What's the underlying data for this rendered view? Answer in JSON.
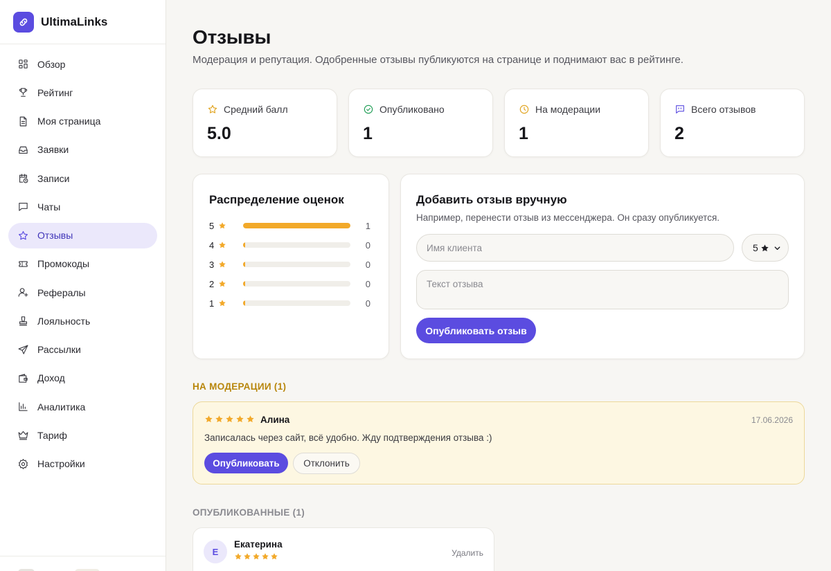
{
  "brand": {
    "name": "UltimaLinks"
  },
  "sidebar": {
    "items": [
      {
        "label": "Обзор",
        "icon": "grid-icon"
      },
      {
        "label": "Рейтинг",
        "icon": "trophy-icon"
      },
      {
        "label": "Моя страница",
        "icon": "page-icon"
      },
      {
        "label": "Заявки",
        "icon": "inbox-icon"
      },
      {
        "label": "Записи",
        "icon": "calendar-clock-icon"
      },
      {
        "label": "Чаты",
        "icon": "chat-icon"
      },
      {
        "label": "Отзывы",
        "icon": "star-icon",
        "active": true
      },
      {
        "label": "Промокоды",
        "icon": "ticket-icon"
      },
      {
        "label": "Рефералы",
        "icon": "user-plus-icon"
      },
      {
        "label": "Лояльность",
        "icon": "stamp-icon"
      },
      {
        "label": "Рассылки",
        "icon": "send-icon"
      },
      {
        "label": "Доход",
        "icon": "wallet-icon"
      },
      {
        "label": "Аналитика",
        "icon": "bar-chart-icon"
      },
      {
        "label": "Тариф",
        "icon": "crown-icon"
      },
      {
        "label": "Настройки",
        "icon": "gear-icon"
      }
    ]
  },
  "header": {
    "title": "Отзывы",
    "subtitle": "Модерация и репутация. Одобренные отзывы публикуются на странице и поднимают вас в рейтинге."
  },
  "stats": [
    {
      "label": "Средний балл",
      "value": "5.0",
      "icon": "star-outline-icon",
      "color": "#e0a21b"
    },
    {
      "label": "Опубликовано",
      "value": "1",
      "icon": "check-circle-icon",
      "color": "#1f9d55"
    },
    {
      "label": "На модерации",
      "value": "1",
      "icon": "clock-icon",
      "color": "#e0a21b"
    },
    {
      "label": "Всего отзывов",
      "value": "2",
      "icon": "message-quote-icon",
      "color": "#5b4ce0"
    }
  ],
  "distribution": {
    "title": "Распределение оценок",
    "rows": [
      {
        "stars": "5",
        "count": "1",
        "fraction": 1.0
      },
      {
        "stars": "4",
        "count": "0",
        "fraction": 0
      },
      {
        "stars": "3",
        "count": "0",
        "fraction": 0
      },
      {
        "stars": "2",
        "count": "0",
        "fraction": 0
      },
      {
        "stars": "1",
        "count": "0",
        "fraction": 0
      }
    ]
  },
  "add_review": {
    "title": "Добавить отзыв вручную",
    "hint": "Например, перенести отзыв из мессенджера. Он сразу опубликуется.",
    "name_placeholder": "Имя клиента",
    "rating_value": "5",
    "text_placeholder": "Текст отзыва",
    "submit_label": "Опубликовать отзыв"
  },
  "moderation": {
    "section_title": "НА МОДЕРАЦИИ (1)",
    "review": {
      "rating": 5,
      "author": "Алина",
      "date": "17.06.2026",
      "text": "Записалась через сайт, всё удобно. Жду подтверждения отзыва :)",
      "approve_label": "Опубликовать",
      "reject_label": "Отклонить"
    }
  },
  "published": {
    "section_title": "ОПУБЛИКОВАННЫЕ (1)",
    "review": {
      "initial": "Е",
      "author": "Екатерина",
      "rating": 5,
      "delete_label": "Удалить"
    }
  },
  "colors": {
    "accent": "#5b4ce0",
    "star": "#f2a92a",
    "moderation_bg": "#fdf7e2"
  }
}
